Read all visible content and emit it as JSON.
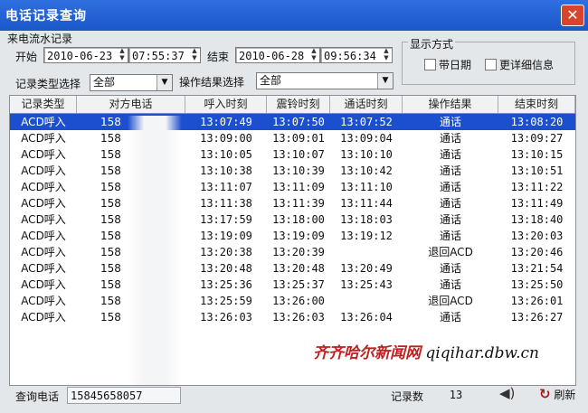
{
  "window": {
    "title": "电话记录查询",
    "close": "✕"
  },
  "section_title": "来电流水记录",
  "filters": {
    "start_label": "开始",
    "start_date": "2010-06-23",
    "start_time": "07:55:37",
    "end_label": "结束",
    "end_date": "2010-06-28",
    "end_time": "09:56:34",
    "record_type_label": "记录类型选择",
    "record_type_value": "全部",
    "op_result_label": "操作结果选择",
    "op_result_value": "全部"
  },
  "display": {
    "group_label": "显示方式",
    "with_date_label": "带日期",
    "more_detail_label": "更详细信息"
  },
  "table": {
    "columns": [
      "记录类型",
      "对方电话",
      "呼入时刻",
      "震铃时刻",
      "通话时刻",
      "操作结果",
      "结束时刻"
    ],
    "rows": [
      [
        "ACD呼入",
        "158",
        "13:07:49",
        "13:07:50",
        "13:07:52",
        "通话",
        "13:08:20"
      ],
      [
        "ACD呼入",
        "158",
        "13:09:00",
        "13:09:01",
        "13:09:04",
        "通话",
        "13:09:27"
      ],
      [
        "ACD呼入",
        "158",
        "13:10:05",
        "13:10:07",
        "13:10:10",
        "通话",
        "13:10:15"
      ],
      [
        "ACD呼入",
        "158",
        "13:10:38",
        "13:10:39",
        "13:10:42",
        "通话",
        "13:10:51"
      ],
      [
        "ACD呼入",
        "158",
        "13:11:07",
        "13:11:09",
        "13:11:10",
        "通话",
        "13:11:22"
      ],
      [
        "ACD呼入",
        "158",
        "13:11:38",
        "13:11:39",
        "13:11:44",
        "通话",
        "13:11:49"
      ],
      [
        "ACD呼入",
        "158",
        "13:17:59",
        "13:18:00",
        "13:18:03",
        "通话",
        "13:18:40"
      ],
      [
        "ACD呼入",
        "158",
        "13:19:09",
        "13:19:09",
        "13:19:12",
        "通话",
        "13:20:03"
      ],
      [
        "ACD呼入",
        "158",
        "13:20:38",
        "13:20:39",
        "",
        "退回ACD",
        "13:20:46"
      ],
      [
        "ACD呼入",
        "158",
        "13:20:48",
        "13:20:48",
        "13:20:49",
        "通话",
        "13:21:54"
      ],
      [
        "ACD呼入",
        "158",
        "13:25:36",
        "13:25:37",
        "13:25:43",
        "通话",
        "13:25:50"
      ],
      [
        "ACD呼入",
        "158",
        "13:25:59",
        "13:26:00",
        "",
        "退回ACD",
        "13:26:01"
      ],
      [
        "ACD呼入",
        "158",
        "13:26:03",
        "13:26:03",
        "13:26:04",
        "通话",
        "13:26:27"
      ]
    ]
  },
  "footer": {
    "query_phone_label": "查询电话",
    "query_phone_value": "15845658057",
    "count_label": "记录数",
    "count_value": "13",
    "refresh_label": "刷新"
  },
  "watermark": {
    "cn": "齐齐哈尔新闻网",
    "url": "qiqihar.dbw.cn"
  },
  "colors": {
    "titlebar": "#1b57c8",
    "selected_row": "#1c4fd0",
    "close": "#d8452c"
  }
}
